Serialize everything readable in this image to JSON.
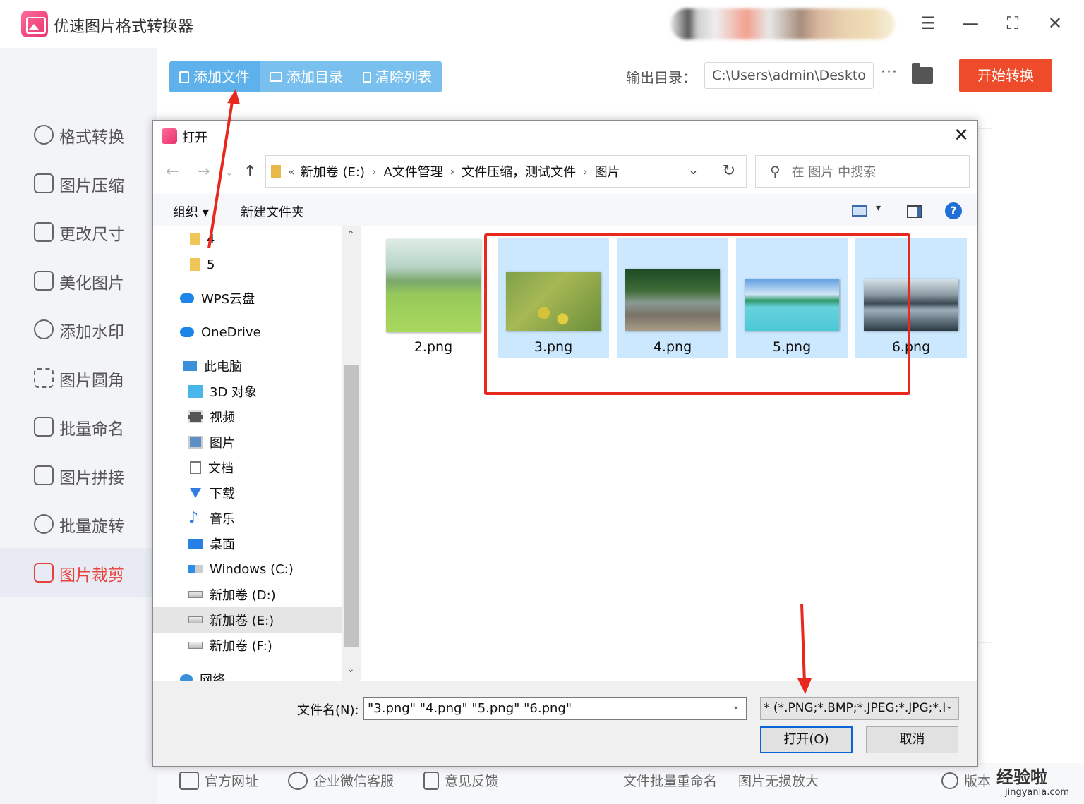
{
  "app": {
    "title": "优速图片格式转换器",
    "window_controls": [
      "menu-icon",
      "minimize-icon",
      "maximize-icon",
      "close-icon"
    ]
  },
  "sidebar": {
    "items": [
      {
        "label": "格式转换",
        "icon": "format-convert-icon"
      },
      {
        "label": "图片压缩",
        "icon": "compress-icon"
      },
      {
        "label": "更改尺寸",
        "icon": "resize-icon"
      },
      {
        "label": "美化图片",
        "icon": "beautify-icon"
      },
      {
        "label": "添加水印",
        "icon": "watermark-icon"
      },
      {
        "label": "图片圆角",
        "icon": "round-corner-icon"
      },
      {
        "label": "批量命名",
        "icon": "rename-icon"
      },
      {
        "label": "图片拼接",
        "icon": "stitch-icon"
      },
      {
        "label": "批量旋转",
        "icon": "rotate-icon"
      },
      {
        "label": "图片裁剪",
        "icon": "crop-icon",
        "active": true
      }
    ]
  },
  "toolbar": {
    "add_file": "添加文件",
    "add_dir": "添加目录",
    "clear_list": "清除列表",
    "output_label": "输出目录：",
    "output_path": "C:\\Users\\admin\\Deskto",
    "more": "···",
    "start": "开始转换"
  },
  "footer": {
    "items": [
      "官方网址",
      "企业微信客服",
      "意见反馈",
      "文件批量重命名",
      "图片无损放大",
      "版本"
    ],
    "watermark": "经验啦",
    "watermark_sub": "jingyanla.com"
  },
  "dialog": {
    "title": "打开",
    "breadcrumb": [
      "«",
      "新加卷 (E:)",
      "A文件管理",
      "文件压缩，测试文件",
      "图片"
    ],
    "search_placeholder": "在 图片 中搜索",
    "organize": "组织 ▾",
    "new_folder": "新建文件夹",
    "help": "?",
    "tree": [
      {
        "label": "4",
        "icon": "folder-icon",
        "indent": 2
      },
      {
        "label": "5",
        "icon": "folder-icon",
        "indent": 2
      },
      {
        "label": "WPS云盘",
        "icon": "wps-cloud-icon",
        "indent": 1
      },
      {
        "label": "OneDrive",
        "icon": "onedrive-icon",
        "indent": 1
      },
      {
        "label": "此电脑",
        "icon": "this-pc-icon",
        "indent": 1
      },
      {
        "label": "3D 对象",
        "icon": "3d-objects-icon",
        "indent": 2
      },
      {
        "label": "视频",
        "icon": "video-icon",
        "indent": 2
      },
      {
        "label": "图片",
        "icon": "pictures-icon",
        "indent": 2
      },
      {
        "label": "文档",
        "icon": "documents-icon",
        "indent": 2
      },
      {
        "label": "下载",
        "icon": "downloads-icon",
        "indent": 2
      },
      {
        "label": "音乐",
        "icon": "music-icon",
        "indent": 2
      },
      {
        "label": "桌面",
        "icon": "desktop-icon",
        "indent": 2
      },
      {
        "label": "Windows (C:)",
        "icon": "windows-drive-icon",
        "indent": 2
      },
      {
        "label": "新加卷 (D:)",
        "icon": "drive-icon",
        "indent": 2
      },
      {
        "label": "新加卷 (E:)",
        "icon": "drive-icon",
        "indent": 2,
        "selected": true
      },
      {
        "label": "新加卷 (F:)",
        "icon": "drive-icon",
        "indent": 2
      },
      {
        "label": "网络",
        "icon": "network-icon",
        "indent": 1
      }
    ],
    "files": [
      {
        "name": "2.png",
        "selected": false
      },
      {
        "name": "3.png",
        "selected": true
      },
      {
        "name": "4.png",
        "selected": true
      },
      {
        "name": "5.png",
        "selected": true
      },
      {
        "name": "6.png",
        "selected": true
      }
    ],
    "filename_label": "文件名(N):",
    "filename_value": "\"3.png\" \"4.png\" \"5.png\" \"6.png\"",
    "filetype_value": "* (*.PNG;*.BMP;*.JPEG;*.JPG;*.I",
    "open_button": "打开(O)",
    "cancel_button": "取消"
  },
  "colors": {
    "accent_red": "#ee4b2b",
    "toolbar_blue": "#5eb1ea",
    "selection_blue": "#cce8ff",
    "annotation_red": "#e8281f"
  }
}
